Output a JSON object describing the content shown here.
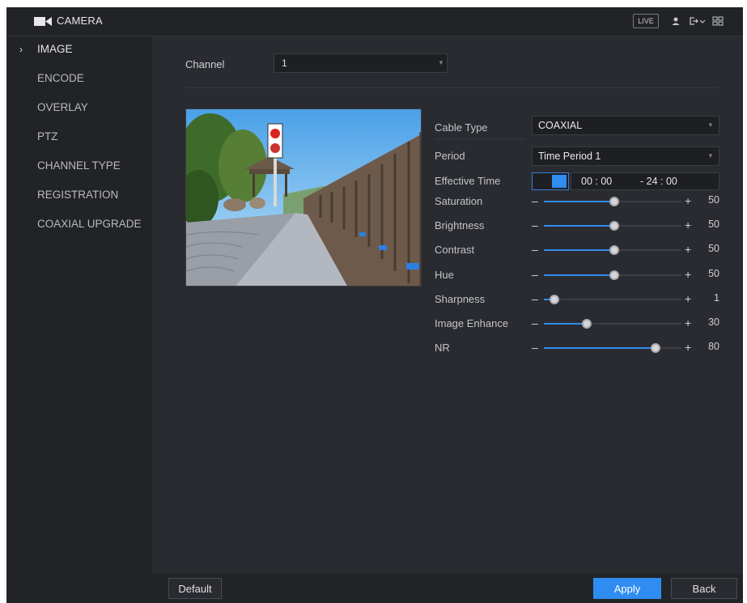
{
  "header": {
    "title": "CAMERA",
    "live_label": "LIVE",
    "icons": [
      "camera-icon",
      "user-icon",
      "logout-icon",
      "chevron-down-icon",
      "grid-icon"
    ]
  },
  "sidebar": {
    "items": [
      {
        "label": "IMAGE",
        "active": true
      },
      {
        "label": "ENCODE",
        "active": false
      },
      {
        "label": "OVERLAY",
        "active": false
      },
      {
        "label": "PTZ",
        "active": false
      },
      {
        "label": "CHANNEL TYPE",
        "active": false
      },
      {
        "label": "REGISTRATION",
        "active": false
      },
      {
        "label": "COAXIAL UPGRADE",
        "active": false
      }
    ]
  },
  "main": {
    "channel_label": "Channel",
    "channel_value": "1",
    "cable_type_label": "Cable Type",
    "cable_type_value": "COAXIAL",
    "period_label": "Period",
    "period_value": "Time Period 1",
    "effective_time_label": "Effective Time",
    "effective_time_enabled": true,
    "time_start": "00 : 00",
    "time_end": "- 24 : 00",
    "sliders": [
      {
        "label": "Saturation",
        "value": 50,
        "max": 100
      },
      {
        "label": "Brightness",
        "value": 50,
        "max": 100
      },
      {
        "label": "Contrast",
        "value": 50,
        "max": 100
      },
      {
        "label": "Hue",
        "value": 50,
        "max": 100
      },
      {
        "label": "Sharpness",
        "value": 1,
        "max": 15
      },
      {
        "label": "Image Enhance",
        "value": 30,
        "max": 100
      },
      {
        "label": "NR",
        "value": 80,
        "max": 100
      }
    ]
  },
  "footer": {
    "default_label": "Default",
    "apply_label": "Apply",
    "back_label": "Back"
  },
  "colors": {
    "accent": "#2f8cf0",
    "background": "#2a2b30",
    "sidebar": "#222327"
  }
}
